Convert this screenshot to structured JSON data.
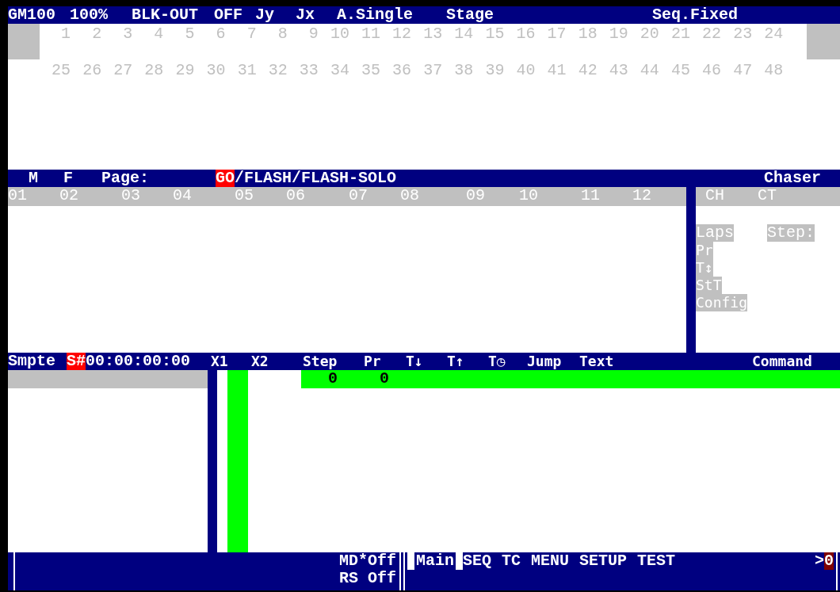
{
  "header": {
    "items": [
      "GM100",
      "100%",
      "BLK-OUT",
      "OFF",
      "Jy",
      "Jx",
      "A.Single",
      "Stage",
      "Seq.Fixed"
    ]
  },
  "channels": [
    "1",
    "2",
    "3",
    "4",
    "5",
    "6",
    "7",
    "8",
    "9",
    "10",
    "11",
    "12",
    "13",
    "14",
    "15",
    "16",
    "17",
    "18",
    "19",
    "20",
    "21",
    "22",
    "23",
    "24",
    "25",
    "26",
    "27",
    "28",
    "29",
    "30",
    "31",
    "32",
    "33",
    "34",
    "35",
    "36",
    "37",
    "38",
    "39",
    "40",
    "41",
    "42",
    "43",
    "44",
    "45",
    "46",
    "47",
    "48"
  ],
  "page_bar": {
    "labels": [
      "M",
      "F",
      "Page:"
    ],
    "modes": [
      {
        "label": "GO",
        "selected": true
      },
      {
        "label": "/FLASH/FLASH-SOLO",
        "selected": false
      }
    ],
    "chaser_title": "Chaser"
  },
  "submasters": [
    "01",
    "02",
    "03",
    "04",
    "05",
    "06",
    "07",
    "08",
    "09",
    "10",
    "11",
    "12"
  ],
  "chaser": {
    "columns": [
      "CH",
      "CT"
    ],
    "laps": "Laps",
    "step": "Step:",
    "fields": [
      "Pr",
      "T↕",
      "StT",
      "Config"
    ]
  },
  "sequence_bar": {
    "smpte": "Smpte",
    "smpte_mark": "S#",
    "timecode": "00:00:00:00",
    "columns": [
      "X1",
      "X2",
      "Step",
      "Pr",
      "T↓",
      "T↑",
      "T◷",
      "Jump",
      "Text",
      "Command"
    ]
  },
  "steps": [
    {
      "step": "0",
      "pr": "0"
    }
  ],
  "status": {
    "lines": [
      "MD*Off",
      "RS Off"
    ],
    "menu": [
      {
        "label": "Main",
        "selected": true
      },
      {
        "label": "SEQ",
        "selected": false
      },
      {
        "label": "TC",
        "selected": false
      },
      {
        "label": "MENU",
        "selected": false
      },
      {
        "label": "SETUP",
        "selected": false
      },
      {
        "label": "TEST",
        "selected": false
      }
    ],
    "prompt": ">",
    "prompt_value": "0"
  }
}
